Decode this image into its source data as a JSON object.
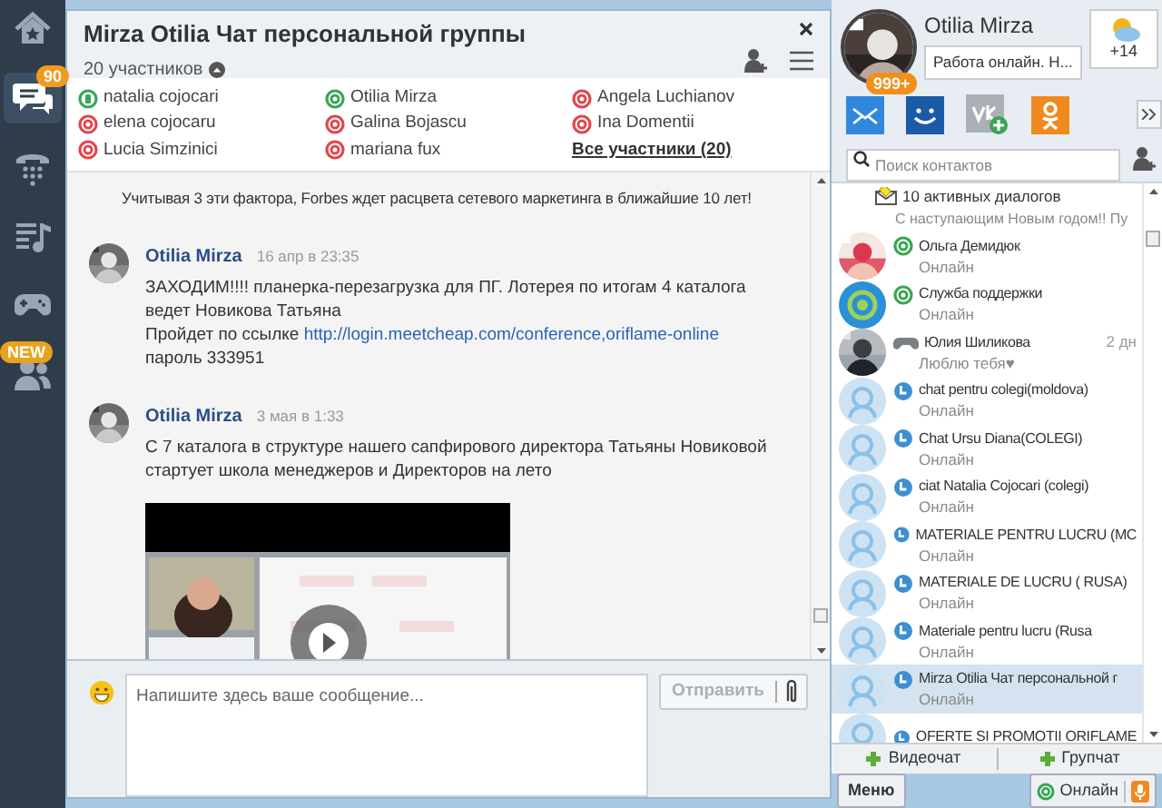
{
  "sidebar": {
    "items": [
      {
        "kind": "home",
        "selected": false
      },
      {
        "kind": "chat",
        "selected": true,
        "badge": "90"
      },
      {
        "kind": "phone",
        "selected": false
      },
      {
        "kind": "music",
        "selected": false
      },
      {
        "kind": "games",
        "selected": false
      },
      {
        "kind": "people",
        "selected": false,
        "badge": "NEW"
      }
    ]
  },
  "chat": {
    "title": "Mirza Otilia  Чат персональной группы",
    "members_count": "20 участников",
    "members": [
      {
        "name": "natalia cojocari",
        "online": true,
        "mobile": true
      },
      {
        "name": "Otilia Mirza",
        "online": true,
        "mobile": false
      },
      {
        "name": "Angela Luchianov",
        "online": false,
        "mobile": false
      },
      {
        "name": "elena cojocaru",
        "online": false,
        "mobile": false
      },
      {
        "name": "Galina Bojascu",
        "online": false,
        "mobile": false
      },
      {
        "name": "Ina Domentii",
        "online": false,
        "mobile": false
      },
      {
        "name": "Lucia Simzinici",
        "online": false,
        "mobile": false
      },
      {
        "name": "mariana fux",
        "online": false,
        "mobile": false
      }
    ],
    "all_members_link": "Все участники (20)",
    "partial_line": "Учитывая 3 эти фактора, Forbes ждет расцвета сетевого маркетинга в ближайшие 10 лет!",
    "messages": [
      {
        "author": "Otilia Mirza",
        "time": "16 апр в 23:35",
        "lines": [
          {
            "text": "ЗАХОДИМ!!!! планерка-перезагрузка для ПГ. Лотерея по итогам 4 каталога"
          },
          {
            "text": "ведет Новикова Татьяна"
          },
          {
            "text": "Пройдет по ссылке ",
            "link": "http://login.meetcheap.com/conference,oriflame-online"
          },
          {
            "text": "пароль 333951"
          }
        ]
      },
      {
        "author": "Otilia Mirza",
        "time": "3 мая в 1:33",
        "lines": [
          {
            "text": "С 7 каталога в структуре нашего сапфирового директора Татьяны Новиковой стартует школа менеджеров и Директоров на лето"
          }
        ],
        "attachment": {
          "kind": "picture"
        }
      }
    ],
    "composer": {
      "placeholder": "Напишите здесь ваше сообщение...",
      "send": "Отправить",
      "send_disabled": true
    }
  },
  "profile": {
    "name": "Otilia Mirza",
    "status_text": "Работа онлайн. Н...",
    "badge": "999+",
    "weather": "+14",
    "search_placeholder": "Поиск контактов",
    "active_dialogs": "10 активных диалогов"
  },
  "contacts": [
    {
      "kind": "partial",
      "preview": "С наступающим Новым годом!! Пу",
      "selected": false
    },
    {
      "kind": "person",
      "name": "Ольга Демидюк",
      "preview": "Онлайн",
      "online": true,
      "selected": false
    },
    {
      "kind": "support",
      "name": "Служба поддержки",
      "preview": "Онлайн",
      "online": true,
      "selected": false
    },
    {
      "kind": "person",
      "name": "Юлия Шиликова",
      "preview": "Люблю тебя♥",
      "in_game": true,
      "time": "2 дн",
      "selected": false
    },
    {
      "kind": "group",
      "name": "chat pentru colegi(moldova)",
      "preview": "Онлайн",
      "selected": false
    },
    {
      "kind": "group",
      "name": "Chat Ursu Diana(COLEGI)",
      "preview": "Онлайн",
      "selected": false
    },
    {
      "kind": "group",
      "name": "ciat Natalia Cojocari (colegi)",
      "preview": "Онлайн",
      "selected": false
    },
    {
      "kind": "group",
      "name": "MATERIALE  PENTRU LUCRU (MC",
      "preview": "Онлайн",
      "selected": false
    },
    {
      "kind": "group",
      "name": "MATERIALE DE LUCRU ( RUSA)",
      "preview": "Онлайн",
      "selected": false
    },
    {
      "kind": "group",
      "name": "Materiale pentru lucru (Rusa",
      "preview": "Онлайн",
      "selected": false
    },
    {
      "kind": "group",
      "name": "Mirza Otilia  Чат персональной г",
      "preview": "Онлайн",
      "selected": true
    },
    {
      "kind": "group",
      "name": "OFERTE SI PROMOTII ORIFLAME",
      "selected": false
    }
  ],
  "bottom": {
    "videochat": "Видеочат",
    "groupchat": "Групчат",
    "menu": "Меню",
    "online": "Онлайн"
  }
}
